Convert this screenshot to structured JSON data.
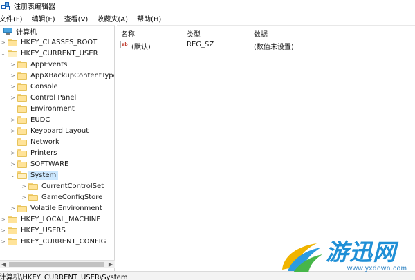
{
  "window": {
    "title": "注册表编辑器"
  },
  "menu": [
    "文件(F)",
    "编辑(E)",
    "查看(V)",
    "收藏夹(A)",
    "帮助(H)"
  ],
  "tree": {
    "root": "计算机",
    "hives": [
      {
        "label": "HKEY_CLASSES_ROOT"
      },
      {
        "label": "HKEY_CURRENT_USER"
      },
      {
        "label": "HKEY_LOCAL_MACHINE"
      },
      {
        "label": "HKEY_USERS"
      },
      {
        "label": "HKEY_CURRENT_CONFIG"
      }
    ],
    "hkcu_children": [
      "AppEvents",
      "AppXBackupContentType",
      "Console",
      "Control Panel",
      "Environment",
      "EUDC",
      "Keyboard Layout",
      "Network",
      "Printers",
      "SOFTWARE",
      "System",
      "Volatile Environment"
    ],
    "system_children": [
      "CurrentControlSet",
      "GameConfigStore"
    ],
    "selected": "System"
  },
  "list": {
    "headers": {
      "name": "名称",
      "type": "类型",
      "data": "数据"
    },
    "rows": [
      {
        "icon": "ab",
        "name": "(默认)",
        "type": "REG_SZ",
        "data": "(数值未设置)"
      }
    ]
  },
  "status": {
    "path": "计算机\\HKEY_CURRENT_USER\\System"
  },
  "watermark": {
    "brand": "游迅网",
    "url": "www.yxdown.com"
  },
  "colors": {
    "selection": "#cce8ff",
    "folder": "#ffe399",
    "brand": "#1f8fd6"
  }
}
